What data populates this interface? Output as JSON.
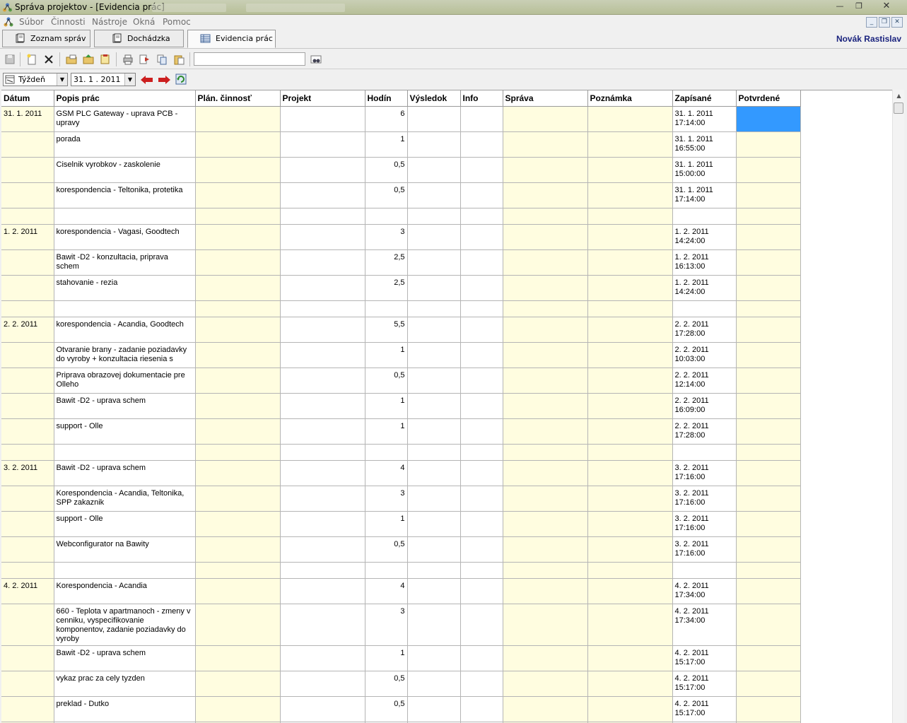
{
  "window": {
    "title": "Správa projektov - [Evidencia prác]",
    "controls": {
      "minimize": "—",
      "maximize": "❐",
      "close": "✕"
    }
  },
  "menu": {
    "items": [
      "Súbor",
      "Činnosti",
      "Nástroje",
      "Okná",
      "Pomoc"
    ],
    "mdi_controls": [
      "_",
      "❐",
      "✕"
    ]
  },
  "tabs": [
    {
      "label": "Zoznam správ",
      "icon": "book-icon"
    },
    {
      "label": "Dochádzka",
      "icon": "book-icon"
    },
    {
      "label": "Evidencia prác",
      "icon": "grid-table-icon"
    }
  ],
  "user": {
    "name": "Novák Rastislav"
  },
  "toolbar": {
    "buttons": [
      "save-icon",
      "new-icon",
      "delete-icon",
      "folder-open-icon",
      "folder-up-icon",
      "document-icon",
      "print-icon",
      "export-icon",
      "copy-icon",
      "paste-icon"
    ],
    "search": {
      "value": "",
      "placeholder": ""
    },
    "search_button_icon": "binoculars-icon"
  },
  "filter": {
    "period": "Týždeň",
    "date": "31.  1 . 2011",
    "nav": [
      "arrow-left-icon",
      "arrow-right-icon",
      "refresh-icon"
    ]
  },
  "colors": {
    "yellow_cell": "#fffde0",
    "selection": "#3399ff",
    "user_name": "#1a237e"
  },
  "grid": {
    "columns": [
      "Dátum",
      "Popis prác",
      "Plán. činnosť",
      "Projekt",
      "Hodín",
      "Výsledok",
      "Info",
      "Správa",
      "Poznámka",
      "Zapísané",
      "Potvrdené"
    ],
    "rows": [
      {
        "datum": "31. 1. 2011",
        "popis": "GSM PLC Gateway - uprava PCB - upravy",
        "hodin": "6",
        "zapisane": "31. 1. 2011 17:14:00",
        "selected": true
      },
      {
        "datum": "",
        "popis": "porada",
        "hodin": "1",
        "zapisane": "31. 1. 2011 16:55:00"
      },
      {
        "datum": "",
        "popis": "Ciselnik vyrobkov - zaskolenie",
        "hodin": "0,5",
        "zapisane": "31. 1. 2011 15:00:00"
      },
      {
        "datum": "",
        "popis": "korespondencia - Teltonika, protetika",
        "hodin": "0,5",
        "zapisane": "31. 1. 2011 17:14:00"
      },
      {
        "blank": true
      },
      {
        "datum": "1. 2. 2011",
        "popis": "korespondencia - Vagasi, Goodtech",
        "hodin": "3",
        "zapisane": "1. 2. 2011 14:24:00"
      },
      {
        "datum": "",
        "popis": "Bawit -D2 - konzultacia, priprava schem",
        "hodin": "2,5",
        "zapisane": "1. 2. 2011 16:13:00"
      },
      {
        "datum": "",
        "popis": "stahovanie - rezia",
        "hodin": "2,5",
        "zapisane": "1. 2. 2011 14:24:00"
      },
      {
        "blank": true
      },
      {
        "datum": "2. 2. 2011",
        "popis": "korespondencia - Acandia, Goodtech",
        "hodin": "5,5",
        "zapisane": "2. 2. 2011 17:28:00"
      },
      {
        "datum": "",
        "popis": "Otvaranie brany - zadanie poziadavky do vyroby + konzultacia riesenia s",
        "hodin": "1",
        "zapisane": "2. 2. 2011 10:03:00"
      },
      {
        "datum": "",
        "popis": "Priprava obrazovej dokumentacie pre Olleho",
        "hodin": "0,5",
        "zapisane": "2. 2. 2011 12:14:00"
      },
      {
        "datum": "",
        "popis": "Bawit -D2 - uprava schem",
        "hodin": "1",
        "zapisane": "2. 2. 2011 16:09:00"
      },
      {
        "datum": "",
        "popis": "support - Olle",
        "hodin": "1",
        "zapisane": "2. 2. 2011 17:28:00"
      },
      {
        "blank": true
      },
      {
        "datum": "3. 2. 2011",
        "popis": "Bawit -D2 - uprava schem",
        "hodin": "4",
        "zapisane": "3. 2. 2011 17:16:00"
      },
      {
        "datum": "",
        "popis": "Korespondencia - Acandia, Teltonika, SPP zakaznik",
        "hodin": "3",
        "zapisane": "3. 2. 2011 17:16:00"
      },
      {
        "datum": "",
        "popis": "support - Olle",
        "hodin": "1",
        "zapisane": "3. 2. 2011 17:16:00"
      },
      {
        "datum": "",
        "popis": "Webconfigurator na Bawity",
        "hodin": "0,5",
        "zapisane": "3. 2. 2011 17:16:00"
      },
      {
        "blank": true
      },
      {
        "datum": "4. 2. 2011",
        "popis": "Korespondencia - Acandia",
        "hodin": "4",
        "zapisane": "4. 2. 2011 17:34:00"
      },
      {
        "datum": "",
        "popis": "660 - Teplota v apartmanoch - zmeny v cenniku, vyspecifikovanie komponentov, zadanie poziadavky do vyroby",
        "hodin": "3",
        "zapisane": "4. 2. 2011 17:34:00",
        "tall": true
      },
      {
        "datum": "",
        "popis": "Bawit -D2 - uprava schem",
        "hodin": "1",
        "zapisane": "4. 2. 2011 15:17:00"
      },
      {
        "datum": "",
        "popis": "vykaz prac za cely tyzden",
        "hodin": "0,5",
        "zapisane": "4. 2. 2011 15:17:00"
      },
      {
        "datum": "",
        "popis": "preklad - Dutko",
        "hodin": "0,5",
        "zapisane": "4. 2. 2011 15:17:00"
      },
      {
        "blank": true
      }
    ]
  }
}
